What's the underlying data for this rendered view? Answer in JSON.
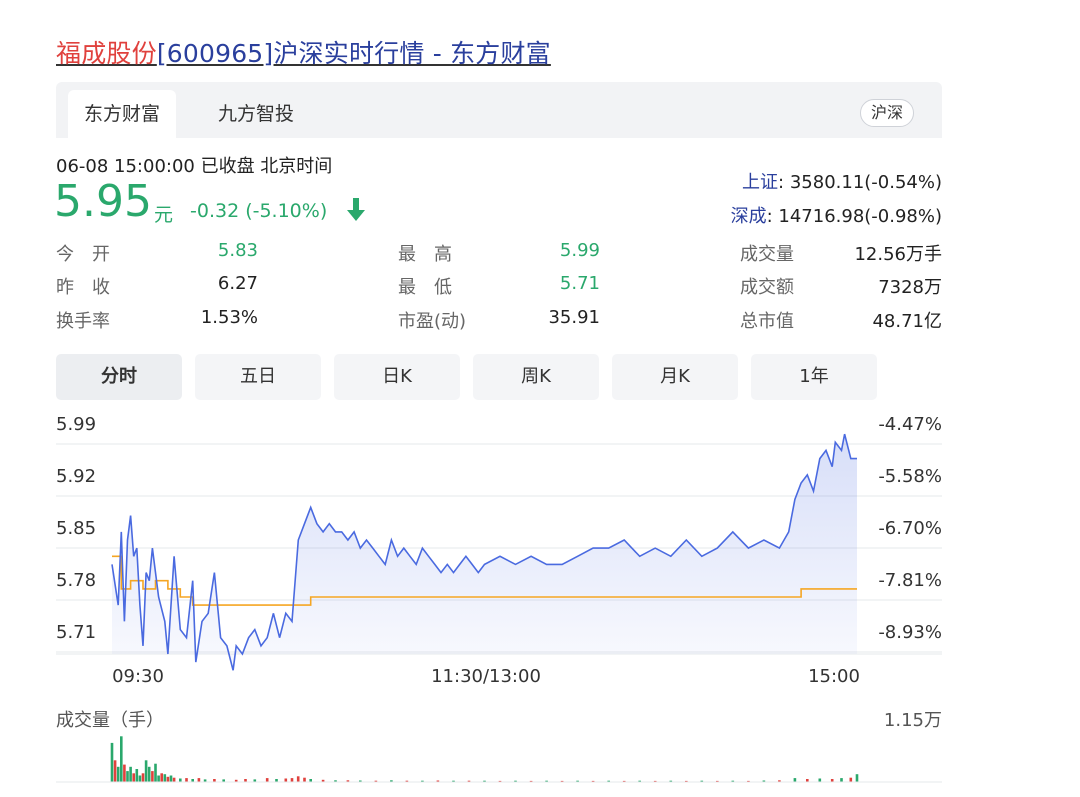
{
  "title": {
    "name": "福成股份",
    "rest": "[600965]沪深实时行情 - 东方财富"
  },
  "tabs": [
    {
      "label": "东方财富",
      "active": true
    },
    {
      "label": "九方智投",
      "active": false
    }
  ],
  "market_badge": "沪深",
  "quote": {
    "time": "06-08 15:00:00  已收盘  北京时间",
    "price": "5.95",
    "unit": "元",
    "change": "-0.32 (-5.10%)",
    "color_down": "#2aa86c"
  },
  "indices": [
    {
      "label": "上证",
      "value": ": 3580.11(-0.54%)"
    },
    {
      "label": "深成",
      "value": ": 14716.98(-0.98%)"
    }
  ],
  "stats": [
    {
      "label": "今　开",
      "value": "5.83",
      "color": "#2aa86c"
    },
    {
      "label": "昨　收",
      "value": "6.27",
      "color": "#222222"
    },
    {
      "label": "换手率",
      "value": "1.53%",
      "color": "#222222"
    },
    {
      "label": "最　高",
      "value": "5.99",
      "color": "#2aa86c"
    },
    {
      "label": "最　低",
      "value": "5.71",
      "color": "#2aa86c"
    },
    {
      "label": "市盈(动)",
      "value": "35.91",
      "color": "#222222"
    },
    {
      "label": "成交量",
      "value": "12.56万手",
      "color": "#222222"
    },
    {
      "label": "成交额",
      "value": "7328万",
      "color": "#222222"
    },
    {
      "label": "总市值",
      "value": "48.71亿",
      "color": "#222222"
    }
  ],
  "periods": [
    {
      "label": "分时",
      "active": true
    },
    {
      "label": "五日",
      "active": false
    },
    {
      "label": "日K",
      "active": false
    },
    {
      "label": "周K",
      "active": false
    },
    {
      "label": "月K",
      "active": false
    },
    {
      "label": "1年",
      "active": false
    }
  ],
  "chart_data": {
    "type": "line",
    "y_ticks": [
      "5.99",
      "5.92",
      "5.85",
      "5.78",
      "5.71"
    ],
    "pct_ticks": [
      "-4.47%",
      "-5.58%",
      "-6.70%",
      "-7.81%",
      "-8.93%"
    ],
    "x_ticks": [
      "09:30",
      "11:30/13:00",
      "15:00"
    ],
    "ylim": [
      5.71,
      5.99
    ],
    "prev_close": 6.27,
    "x_range": [
      0,
      240
    ],
    "series": [
      {
        "role": "price",
        "color": "#4a6ae0",
        "x": [
          0,
          2,
          3,
          4,
          5,
          6,
          7,
          8,
          9,
          10,
          11,
          12,
          13,
          15,
          17,
          18,
          20,
          22,
          24,
          26,
          27,
          29,
          31,
          33,
          35,
          37,
          39,
          40,
          42,
          44,
          46,
          48,
          50,
          52,
          54,
          56,
          58,
          60,
          62,
          64,
          66,
          68,
          70,
          72,
          74,
          76,
          78,
          80,
          82,
          84,
          86,
          88,
          90,
          92,
          94,
          96,
          98,
          100,
          102,
          104,
          106,
          108,
          110,
          112,
          114,
          116,
          118,
          120,
          125,
          130,
          135,
          140,
          145,
          150,
          155,
          160,
          165,
          170,
          175,
          180,
          185,
          190,
          195,
          200,
          205,
          210,
          215,
          218,
          220,
          222,
          224,
          226,
          228,
          230,
          232,
          233,
          235,
          236,
          238,
          240
        ],
        "values": [
          5.82,
          5.77,
          5.86,
          5.75,
          5.85,
          5.88,
          5.83,
          5.84,
          5.77,
          5.72,
          5.81,
          5.8,
          5.84,
          5.78,
          5.75,
          5.71,
          5.83,
          5.74,
          5.73,
          5.8,
          5.7,
          5.75,
          5.76,
          5.81,
          5.73,
          5.72,
          5.69,
          5.72,
          5.71,
          5.73,
          5.74,
          5.72,
          5.73,
          5.76,
          5.73,
          5.76,
          5.75,
          5.85,
          5.87,
          5.89,
          5.87,
          5.86,
          5.87,
          5.86,
          5.86,
          5.85,
          5.86,
          5.84,
          5.85,
          5.84,
          5.83,
          5.82,
          5.85,
          5.83,
          5.84,
          5.83,
          5.82,
          5.84,
          5.83,
          5.82,
          5.81,
          5.82,
          5.81,
          5.82,
          5.83,
          5.82,
          5.81,
          5.82,
          5.83,
          5.82,
          5.83,
          5.82,
          5.82,
          5.83,
          5.84,
          5.84,
          5.85,
          5.83,
          5.84,
          5.83,
          5.85,
          5.83,
          5.84,
          5.86,
          5.84,
          5.85,
          5.84,
          5.86,
          5.9,
          5.92,
          5.93,
          5.91,
          5.95,
          5.96,
          5.94,
          5.97,
          5.96,
          5.98,
          5.95,
          5.95
        ]
      },
      {
        "role": "average",
        "color": "#f5a623",
        "x": [
          0,
          3,
          6,
          10,
          14,
          18,
          22,
          26,
          30,
          35,
          40,
          45,
          50,
          55,
          60,
          64,
          70,
          80,
          100,
          120,
          140,
          160,
          180,
          200,
          215,
          220,
          222,
          230,
          238,
          240
        ],
        "values": [
          5.83,
          5.79,
          5.8,
          5.79,
          5.8,
          5.79,
          5.78,
          5.77,
          5.77,
          5.77,
          5.77,
          5.77,
          5.77,
          5.77,
          5.77,
          5.78,
          5.78,
          5.78,
          5.78,
          5.78,
          5.78,
          5.78,
          5.78,
          5.78,
          5.78,
          5.78,
          5.79,
          5.79,
          5.79,
          5.79
        ]
      }
    ]
  },
  "volume": {
    "title": "成交量（手）",
    "max_label": "1.15万",
    "max": 11500,
    "up_color": "#e0413d",
    "down_color": "#2aa86c",
    "bars": [
      {
        "x": 0,
        "v": 9000,
        "d": 1
      },
      {
        "x": 1,
        "v": 5000,
        "d": 0
      },
      {
        "x": 2,
        "v": 3500,
        "d": 1
      },
      {
        "x": 3,
        "v": 10500,
        "d": 1
      },
      {
        "x": 4,
        "v": 4000,
        "d": 0
      },
      {
        "x": 5,
        "v": 2500,
        "d": 1
      },
      {
        "x": 6,
        "v": 3500,
        "d": 1
      },
      {
        "x": 7,
        "v": 2000,
        "d": 0
      },
      {
        "x": 8,
        "v": 3000,
        "d": 1
      },
      {
        "x": 9,
        "v": 1500,
        "d": 1
      },
      {
        "x": 10,
        "v": 2000,
        "d": 0
      },
      {
        "x": 11,
        "v": 5000,
        "d": 1
      },
      {
        "x": 12,
        "v": 3500,
        "d": 1
      },
      {
        "x": 13,
        "v": 2500,
        "d": 0
      },
      {
        "x": 14,
        "v": 4200,
        "d": 1
      },
      {
        "x": 15,
        "v": 1500,
        "d": 1
      },
      {
        "x": 16,
        "v": 2000,
        "d": 0
      },
      {
        "x": 17,
        "v": 1800,
        "d": 1
      },
      {
        "x": 18,
        "v": 1200,
        "d": 0
      },
      {
        "x": 19,
        "v": 1500,
        "d": 1
      },
      {
        "x": 20,
        "v": 1000,
        "d": 0
      },
      {
        "x": 22,
        "v": 800,
        "d": 1
      },
      {
        "x": 24,
        "v": 900,
        "d": 0
      },
      {
        "x": 26,
        "v": 700,
        "d": 1
      },
      {
        "x": 28,
        "v": 900,
        "d": 0
      },
      {
        "x": 30,
        "v": 600,
        "d": 1
      },
      {
        "x": 33,
        "v": 700,
        "d": 0
      },
      {
        "x": 36,
        "v": 600,
        "d": 1
      },
      {
        "x": 40,
        "v": 500,
        "d": 0
      },
      {
        "x": 43,
        "v": 700,
        "d": 0
      },
      {
        "x": 46,
        "v": 600,
        "d": 1
      },
      {
        "x": 50,
        "v": 900,
        "d": 0
      },
      {
        "x": 53,
        "v": 700,
        "d": 1
      },
      {
        "x": 56,
        "v": 800,
        "d": 0
      },
      {
        "x": 58,
        "v": 900,
        "d": 0
      },
      {
        "x": 60,
        "v": 1300,
        "d": 0
      },
      {
        "x": 62,
        "v": 1000,
        "d": 0
      },
      {
        "x": 64,
        "v": 700,
        "d": 1
      },
      {
        "x": 68,
        "v": 500,
        "d": 0
      },
      {
        "x": 72,
        "v": 400,
        "d": 1
      },
      {
        "x": 76,
        "v": 400,
        "d": 0
      },
      {
        "x": 80,
        "v": 350,
        "d": 1
      },
      {
        "x": 85,
        "v": 300,
        "d": 0
      },
      {
        "x": 90,
        "v": 400,
        "d": 1
      },
      {
        "x": 95,
        "v": 300,
        "d": 0
      },
      {
        "x": 100,
        "v": 300,
        "d": 1
      },
      {
        "x": 105,
        "v": 350,
        "d": 0
      },
      {
        "x": 110,
        "v": 300,
        "d": 1
      },
      {
        "x": 115,
        "v": 300,
        "d": 0
      },
      {
        "x": 120,
        "v": 300,
        "d": 1
      },
      {
        "x": 125,
        "v": 250,
        "d": 0
      },
      {
        "x": 130,
        "v": 300,
        "d": 1
      },
      {
        "x": 135,
        "v": 250,
        "d": 0
      },
      {
        "x": 140,
        "v": 300,
        "d": 1
      },
      {
        "x": 145,
        "v": 250,
        "d": 0
      },
      {
        "x": 150,
        "v": 300,
        "d": 1
      },
      {
        "x": 155,
        "v": 250,
        "d": 0
      },
      {
        "x": 160,
        "v": 300,
        "d": 1
      },
      {
        "x": 165,
        "v": 250,
        "d": 0
      },
      {
        "x": 170,
        "v": 300,
        "d": 1
      },
      {
        "x": 175,
        "v": 250,
        "d": 0
      },
      {
        "x": 180,
        "v": 300,
        "d": 1
      },
      {
        "x": 185,
        "v": 250,
        "d": 0
      },
      {
        "x": 190,
        "v": 300,
        "d": 1
      },
      {
        "x": 195,
        "v": 250,
        "d": 0
      },
      {
        "x": 200,
        "v": 300,
        "d": 1
      },
      {
        "x": 205,
        "v": 250,
        "d": 0
      },
      {
        "x": 210,
        "v": 350,
        "d": 1
      },
      {
        "x": 215,
        "v": 400,
        "d": 0
      },
      {
        "x": 220,
        "v": 900,
        "d": 1
      },
      {
        "x": 224,
        "v": 700,
        "d": 0
      },
      {
        "x": 228,
        "v": 800,
        "d": 1
      },
      {
        "x": 232,
        "v": 700,
        "d": 0
      },
      {
        "x": 235,
        "v": 900,
        "d": 1
      },
      {
        "x": 238,
        "v": 1000,
        "d": 0
      },
      {
        "x": 240,
        "v": 1800,
        "d": 1
      }
    ]
  }
}
